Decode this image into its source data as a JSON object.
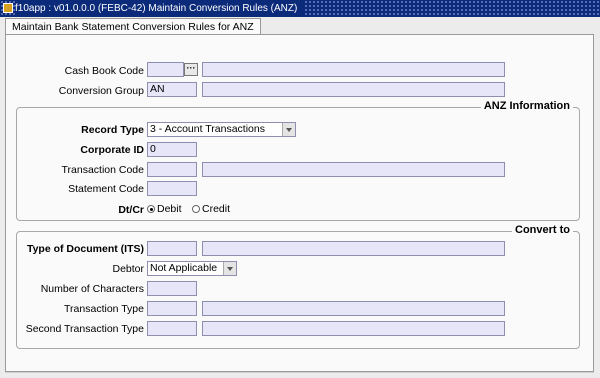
{
  "window": {
    "title": "f10app : v01.0.0.0 (FEBC-42) Maintain Conversion Rules (ANZ)"
  },
  "tab": {
    "label": "Maintain Bank Statement Conversion Rules for ANZ"
  },
  "header_fields": {
    "cash_book_code": {
      "label": "Cash Book Code",
      "value": "",
      "lookup_icon": "ellipsis-icon"
    },
    "conversion_group": {
      "label": "Conversion Group",
      "value": "AN"
    }
  },
  "anz_information": {
    "title": "ANZ Information",
    "record_type": {
      "label": "Record Type",
      "value": "3 - Account Transactions"
    },
    "corporate_id": {
      "label": "Corporate ID",
      "value": "0"
    },
    "transaction_code": {
      "label": "Transaction Code",
      "value": ""
    },
    "statement_code": {
      "label": "Statement Code",
      "value": ""
    },
    "dt_cr": {
      "label": "Dt/Cr",
      "options": [
        {
          "label": "Debit",
          "selected": true
        },
        {
          "label": "Credit",
          "selected": false
        }
      ]
    }
  },
  "convert_to": {
    "title": "Convert to",
    "type_of_document": {
      "label": "Type of Document  (ITS)",
      "value": ""
    },
    "debtor": {
      "label": "Debtor",
      "value": "Not Applicable"
    },
    "number_of_characters": {
      "label": "Number of Characters",
      "value": ""
    },
    "transaction_type": {
      "label": "Transaction Type",
      "value": ""
    },
    "second_transaction_type": {
      "label": "Second Transaction Type",
      "value": ""
    }
  },
  "colors": {
    "titlebar": "#0b2a7a",
    "input_bg": "#e6e6f8",
    "pane_bg": "#fafafa"
  }
}
